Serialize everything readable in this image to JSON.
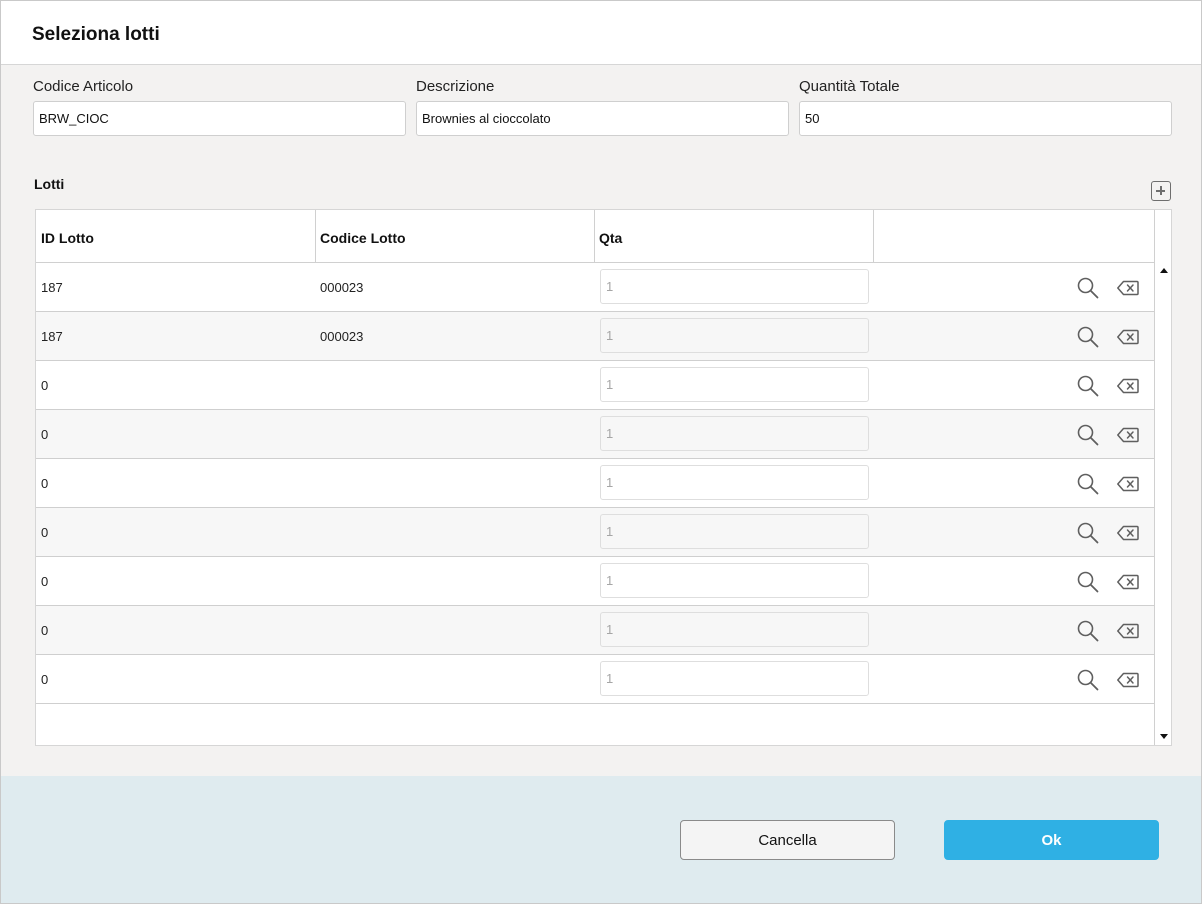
{
  "dialog": {
    "title": "Seleziona lotti"
  },
  "fields": {
    "codice_articolo": {
      "label": "Codice Articolo",
      "value": "BRW_CIOC"
    },
    "descrizione": {
      "label": "Descrizione",
      "value": "Brownies al cioccolato"
    },
    "quantita_totale": {
      "label": "Quantità Totale",
      "value": "50"
    }
  },
  "lotti": {
    "title": "Lotti",
    "add_icon": "plus-square-icon",
    "columns": [
      "ID Lotto",
      "Codice Lotto",
      "Qta",
      ""
    ],
    "rows": [
      {
        "id_lotto": "187",
        "codice_lotto": "000023",
        "qta": "1"
      },
      {
        "id_lotto": "187",
        "codice_lotto": "000023",
        "qta": "1"
      },
      {
        "id_lotto": "0",
        "codice_lotto": "",
        "qta": "1"
      },
      {
        "id_lotto": "0",
        "codice_lotto": "",
        "qta": "1"
      },
      {
        "id_lotto": "0",
        "codice_lotto": "",
        "qta": "1"
      },
      {
        "id_lotto": "0",
        "codice_lotto": "",
        "qta": "1"
      },
      {
        "id_lotto": "0",
        "codice_lotto": "",
        "qta": "1"
      },
      {
        "id_lotto": "0",
        "codice_lotto": "",
        "qta": "1"
      },
      {
        "id_lotto": "0",
        "codice_lotto": "",
        "qta": "1"
      }
    ],
    "row_icons": [
      "search-icon",
      "backspace-icon"
    ]
  },
  "footer": {
    "cancel_label": "Cancella",
    "ok_label": "Ok"
  },
  "colors": {
    "accent": "#2fb0e4",
    "footer_bg": "#dfebef",
    "body_bg": "#f3f2f1"
  }
}
